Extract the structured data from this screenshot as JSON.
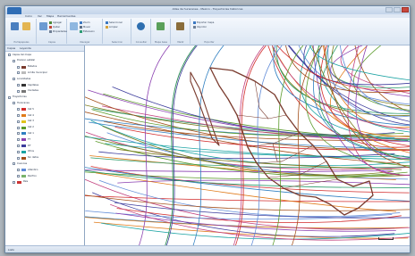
{
  "window": {
    "title": "Atlas de huracanes - Mexico - Trayectorias historicas"
  },
  "ribbon": {
    "tabs": [
      "Inicio",
      "Ver",
      "Mapa",
      "Herramientas"
    ],
    "groups": [
      {
        "label": "Portapapeles",
        "big": "Abrir",
        "small": []
      },
      {
        "label": "Capas",
        "big": "",
        "small": [
          "Agregar",
          "Quitar",
          "Propiedades"
        ]
      },
      {
        "label": "Navegar",
        "big": "",
        "small": [
          "Zoom",
          "Mover",
          "Extension"
        ]
      },
      {
        "label": "Seleccion",
        "big": "",
        "small": [
          "Seleccionar",
          "Limpiar"
        ]
      },
      {
        "label": "Consultar",
        "big": "Identificar",
        "small": []
      },
      {
        "label": "Mapa base",
        "big": "Base",
        "small": []
      },
      {
        "label": "Medir",
        "big": "Medir",
        "small": []
      },
      {
        "label": "Exportar",
        "big": "",
        "small": [
          "Exportar mapa",
          "Imprimir"
        ]
      }
    ]
  },
  "panel": {
    "tabs": [
      "Capas",
      "Leyenda"
    ],
    "rows": [
      {
        "label": "Capas del mapa",
        "indent": 0,
        "swatch": "",
        "group": true
      },
      {
        "label": "Division estatal",
        "indent": 1,
        "swatch": "",
        "group": true
      },
      {
        "label": "Estados",
        "indent": 2,
        "swatch": "#7a3b2e",
        "group": false
      },
      {
        "label": "Limite municipal",
        "indent": 2,
        "swatch": "#bbbbbb",
        "group": false
      },
      {
        "label": "Localidades",
        "indent": 1,
        "swatch": "",
        "group": true
      },
      {
        "label": "Capitales",
        "indent": 2,
        "swatch": "#333333",
        "group": false
      },
      {
        "label": "Ciudades",
        "indent": 2,
        "swatch": "#777777",
        "group": false
      },
      {
        "label": "Trayectorias",
        "indent": 0,
        "swatch": "",
        "group": true
      },
      {
        "label": "Huracanes",
        "indent": 1,
        "swatch": "",
        "group": true
      },
      {
        "label": "Cat 5",
        "indent": 2,
        "swatch": "#d22b2b",
        "group": false
      },
      {
        "label": "Cat 4",
        "indent": 2,
        "swatch": "#e07b1a",
        "group": false
      },
      {
        "label": "Cat 3",
        "indent": 2,
        "swatch": "#e0c31a",
        "group": false
      },
      {
        "label": "Cat 2",
        "indent": 2,
        "swatch": "#5a9a2a",
        "group": false
      },
      {
        "label": "Cat 1",
        "indent": 2,
        "swatch": "#2f7fc1",
        "group": false
      },
      {
        "label": "TT",
        "indent": 2,
        "swatch": "#8a3fb0",
        "group": false
      },
      {
        "label": "DT",
        "indent": 2,
        "swatch": "#3c3c9c",
        "group": false
      },
      {
        "label": "Otros",
        "indent": 2,
        "swatch": "#1aa3a3",
        "group": false
      },
      {
        "label": "Sin datos",
        "indent": 2,
        "swatch": "#a34f1a",
        "group": false
      },
      {
        "label": "Cuencas",
        "indent": 1,
        "swatch": "",
        "group": true
      },
      {
        "label": "Atlantico",
        "indent": 2,
        "swatch": "#5f8bd8",
        "group": false
      },
      {
        "label": "Pacifico",
        "indent": 2,
        "swatch": "#79b36b",
        "group": false
      },
      {
        "label": "Pais",
        "indent": 1,
        "swatch": "#cc3333",
        "group": false
      }
    ]
  },
  "map": {
    "track_colors": [
      "#d22b2b",
      "#2f7fc1",
      "#5a9a2a",
      "#8a3fb0",
      "#e07b1a",
      "#1aa3a3",
      "#c2417f",
      "#3c3c9c",
      "#7a7a1a",
      "#a34f1a",
      "#2a9b6a",
      "#5f8bd8"
    ],
    "border_color": "#7a3b2e"
  },
  "statusbar": {
    "text": "Listo"
  }
}
